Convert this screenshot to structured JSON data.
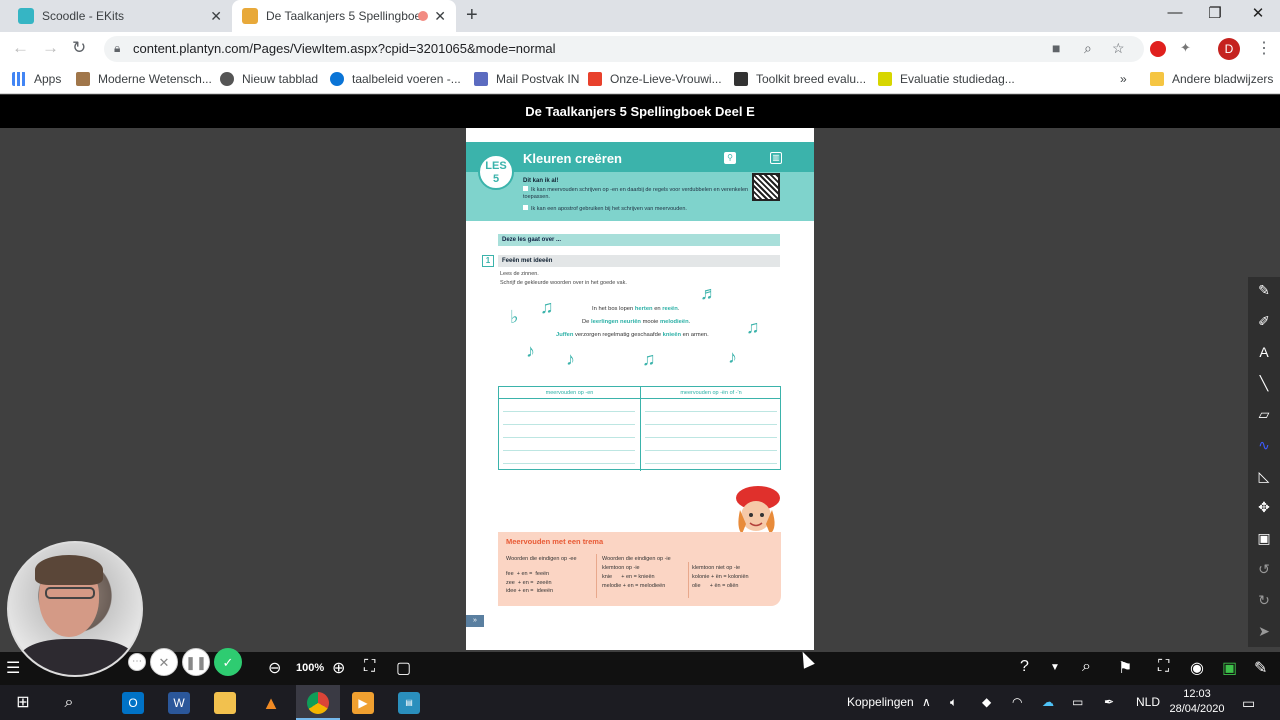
{
  "tabs": [
    {
      "title": "Scoodle - EKits",
      "color": "#36b5c4"
    },
    {
      "title": "De Taalkanjers 5 Spellingboe",
      "color": "#e8a93a"
    }
  ],
  "address": {
    "url": "content.plantyn.com/Pages/ViewItem.aspx?cpid=3201065&mode=normal"
  },
  "profile_initial": "D",
  "bookmarks": [
    {
      "label": "Apps"
    },
    {
      "label": "Moderne Wetensch..."
    },
    {
      "label": "Nieuw tabblad"
    },
    {
      "label": "taalbeleid voeren -..."
    },
    {
      "label": "Mail Postvak IN"
    },
    {
      "label": "Onze-Lieve-Vrouwi..."
    },
    {
      "label": "Toolkit breed evalu..."
    },
    {
      "label": "Evaluatie studiedag..."
    },
    {
      "label": "Andere bladwijzers"
    }
  ],
  "viewer": {
    "title": "De Taalkanjers 5 Spellingboek Deel E",
    "zoom": "100%"
  },
  "page": {
    "les_label": "LES",
    "les_number": "5",
    "lesson_title": "Kleuren creëren",
    "can_heading": "Dit kan ik al!",
    "can_items": [
      "Ik kan meervouden schrijven op -en en daarbij de regels voor verdubbelen en verenkelen toepassen.",
      "Ik kan een apostrof gebruiken bij het schrijven van meervouden."
    ],
    "about_bar": "Deze les gaat over ...",
    "exercise_number": "1",
    "exercise_title": "Feeën met ideeën",
    "instructions": [
      "Lees de zinnen.",
      "Schrijf de gekleurde woorden over in het goede vak."
    ],
    "sentences": [
      {
        "pre": "In het bos lopen ",
        "w1": "herten",
        "mid": " en ",
        "w2": "reeën",
        "post": "."
      },
      {
        "pre": "De ",
        "w1": "leerlingen neuriën",
        "mid": " mooie ",
        "w2": "melodieën",
        "post": "."
      },
      {
        "pre": "",
        "w1": "Juffen",
        "mid": " verzorgen regelmatig geschaafde ",
        "w2": "knieën",
        "post": " en armen."
      }
    ],
    "table_headers": [
      "meervouden op -en",
      "meervouden op -ën of -'n"
    ],
    "trema_title": "Meervouden met een trema",
    "trema_col1_head": "Woorden die eindigen op -ee",
    "trema_col1": "fee  + en =  feeën\nzee  + en =  zeeën\nidee + en =  ideeën",
    "trema_col2_head": "Woorden die eindigen op -ie\nklemtoon op -ie",
    "trema_col2": "knie      + en = knieën\nmelodie + en = melodieën",
    "trema_col3_head": "klemtoon niet op -ie",
    "trema_col3": "kolonie + ën = koloniën\nolie      + ën = oliën",
    "page_arrow": "»"
  },
  "taskbar": {
    "koppelingen": "Koppelingen",
    "lang": "NLD",
    "time": "12:03",
    "date": "28/04/2020"
  }
}
